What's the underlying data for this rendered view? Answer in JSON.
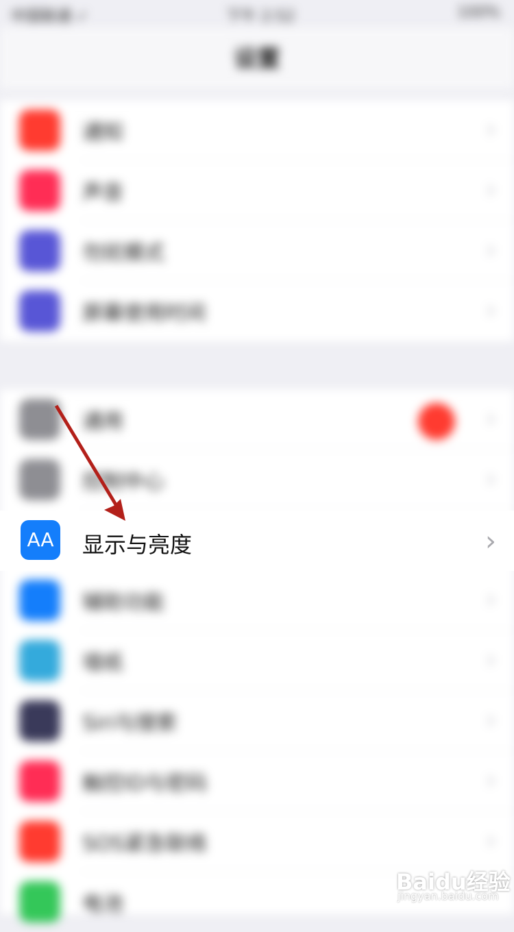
{
  "status_bar": {
    "carrier": "中国联通 ✓",
    "time": "下午 2:52",
    "battery": "100%"
  },
  "nav": {
    "title": "设置"
  },
  "group1": [
    {
      "label": "通知",
      "color": "#ff3b30"
    },
    {
      "label": "声音",
      "color": "#ff2d55"
    },
    {
      "label": "勿扰模式",
      "color": "#5856d6"
    },
    {
      "label": "屏幕使用时间",
      "color": "#5856d6"
    }
  ],
  "group2": [
    {
      "label": "通用",
      "color": "#8e8e93"
    },
    {
      "label": "控制中心",
      "color": "#8e8e93"
    },
    {
      "label": "显示与亮度",
      "color": "#147efb",
      "highlight": true,
      "icon_text": "AA"
    },
    {
      "label": "辅助功能",
      "color": "#147efb"
    },
    {
      "label": "墙纸",
      "color": "#34aadc"
    },
    {
      "label": "Siri与搜索",
      "color": "#3a3a5a"
    },
    {
      "label": "触控ID与密码",
      "color": "#ff2d55"
    },
    {
      "label": "SOS紧急联络",
      "color": "#ff3b30"
    },
    {
      "label": "电池",
      "color": "#34c759"
    }
  ],
  "watermark": {
    "brand": "Baidu经验",
    "url": "jingyan.baidu.com"
  }
}
